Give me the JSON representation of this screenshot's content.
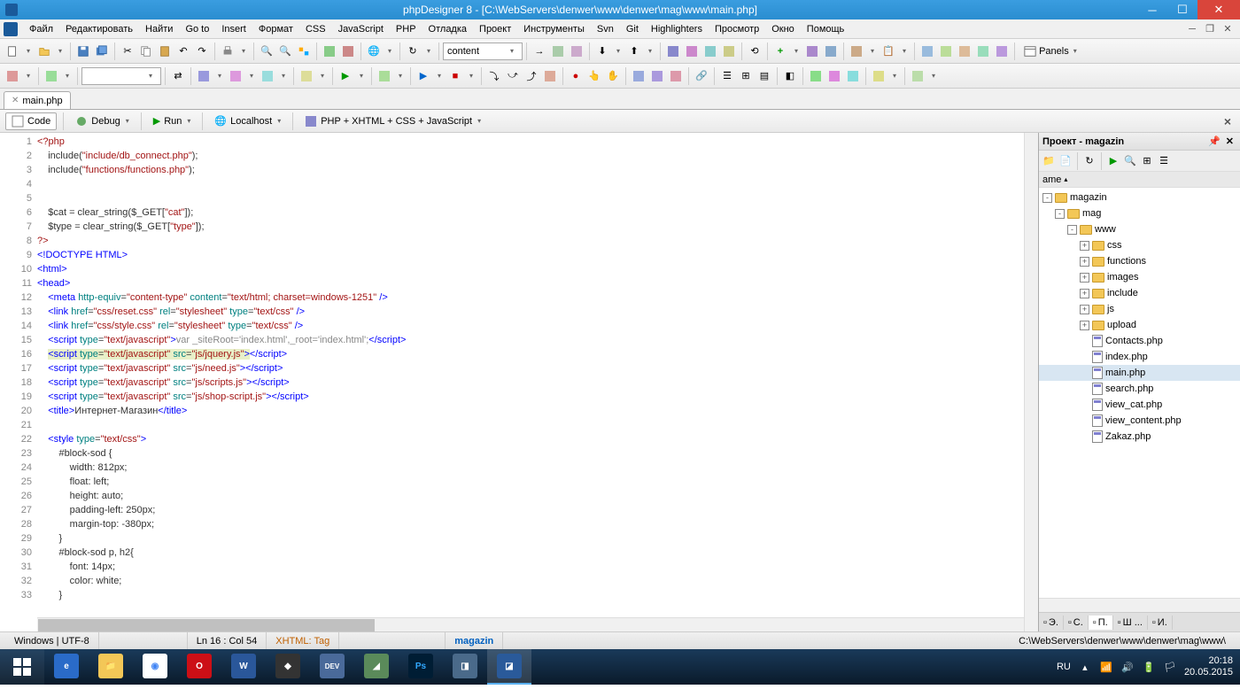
{
  "titlebar": {
    "text": "phpDesigner 8 - [C:\\WebServers\\denwer\\www\\denwer\\mag\\www\\main.php]"
  },
  "menu": [
    "Файл",
    "Редактировать",
    "Найти",
    "Go to",
    "Insert",
    "Формат",
    "CSS",
    "JavaScript",
    "PHP",
    "Отладка",
    "Проект",
    "Инструменты",
    "Svn",
    "Git",
    "Highlighters",
    "Просмотр",
    "Окно",
    "Помощь"
  ],
  "toolbar1": {
    "combo_content": "content",
    "panels_label": "Panels"
  },
  "tab": {
    "name": "main.php"
  },
  "subtoolbar": {
    "code": "Code",
    "debug": "Debug",
    "run": "Run",
    "localhost": "Localhost",
    "lang": "PHP + XHTML + CSS + JavaScript"
  },
  "code": {
    "lines": [
      {
        "n": 1,
        "html": "<span class='kw-red'>&lt;?php</span>"
      },
      {
        "n": 2,
        "html": "    include(<span class='kw-str'>\"include/db_connect.php\"</span>);"
      },
      {
        "n": 3,
        "html": "    include(<span class='kw-str'>\"functions/functions.php\"</span>);"
      },
      {
        "n": 4,
        "html": ""
      },
      {
        "n": 5,
        "html": ""
      },
      {
        "n": 6,
        "html": "    $cat = clear_string($_GET[<span class='kw-str'>\"cat\"</span>]);"
      },
      {
        "n": 7,
        "html": "    $type = clear_string($_GET[<span class='kw-str'>\"type\"</span>]);"
      },
      {
        "n": 8,
        "html": "<span class='kw-red'>?&gt;</span>"
      },
      {
        "n": 9,
        "html": "<span class='kw-blue'>&lt;!DOCTYPE HTML&gt;</span>"
      },
      {
        "n": 10,
        "html": "<span class='kw-blue'>&lt;html&gt;</span>"
      },
      {
        "n": 11,
        "html": "<span class='kw-blue'>&lt;head&gt;</span>"
      },
      {
        "n": 12,
        "html": "    <span class='kw-blue'>&lt;meta</span> <span class='kw-teal'>http-equiv</span>=<span class='kw-str'>\"content-type\"</span> <span class='kw-teal'>content</span>=<span class='kw-str'>\"text/html; charset=windows-1251\"</span> <span class='kw-blue'>/&gt;</span>"
      },
      {
        "n": 13,
        "html": "    <span class='kw-blue'>&lt;link</span> <span class='kw-teal'>href</span>=<span class='kw-str'>\"css/reset.css\"</span> <span class='kw-teal'>rel</span>=<span class='kw-str'>\"stylesheet\"</span> <span class='kw-teal'>type</span>=<span class='kw-str'>\"text/css\"</span> <span class='kw-blue'>/&gt;</span>"
      },
      {
        "n": 14,
        "html": "    <span class='kw-blue'>&lt;link</span> <span class='kw-teal'>href</span>=<span class='kw-str'>\"css/style.css\"</span> <span class='kw-teal'>rel</span>=<span class='kw-str'>\"stylesheet\"</span> <span class='kw-teal'>type</span>=<span class='kw-str'>\"text/css\"</span> <span class='kw-blue'>/&gt;</span>"
      },
      {
        "n": 15,
        "html": "    <span class='kw-blue'>&lt;script</span> <span class='kw-teal'>type</span>=<span class='kw-str'>\"text/javascript\"</span><span class='kw-blue'>&gt;</span><span class='kw-gray'>var _siteRoot='index.html',_root='index.html';</span><span class='kw-blue'>&lt;/script&gt;</span>"
      },
      {
        "n": 16,
        "html": "    <span style='background:#e8f0c8'><span class='kw-blue'>&lt;script</span> <span class='kw-teal'>type</span>=<span class='kw-str'>\"text/javascript\"</span> <span class='kw-teal'>src</span>=<span class='kw-str'>\"js/jquery.js\"</span><span class='kw-blue'>&gt;</span></span><span class='kw-blue'>&lt;/script&gt;</span>"
      },
      {
        "n": 17,
        "html": "    <span class='kw-blue'>&lt;script</span> <span class='kw-teal'>type</span>=<span class='kw-str'>\"text/javascript\"</span> <span class='kw-teal'>src</span>=<span class='kw-str'>\"js/need.js\"</span><span class='kw-blue'>&gt;&lt;/script&gt;</span>"
      },
      {
        "n": 18,
        "html": "    <span class='kw-blue'>&lt;script</span> <span class='kw-teal'>type</span>=<span class='kw-str'>\"text/javascript\"</span> <span class='kw-teal'>src</span>=<span class='kw-str'>\"js/scripts.js\"</span><span class='kw-blue'>&gt;&lt;/script&gt;</span>"
      },
      {
        "n": 19,
        "html": "    <span class='kw-blue'>&lt;script</span> <span class='kw-teal'>type</span>=<span class='kw-str'>\"text/javascript\"</span> <span class='kw-teal'>src</span>=<span class='kw-str'>\"js/shop-script.js\"</span><span class='kw-blue'>&gt;&lt;/script&gt;</span>"
      },
      {
        "n": 20,
        "html": "    <span class='kw-blue'>&lt;title&gt;</span>Интернет-Магазин<span class='kw-blue'>&lt;/title&gt;</span>"
      },
      {
        "n": 21,
        "html": ""
      },
      {
        "n": 22,
        "html": "    <span class='kw-blue'>&lt;style</span> <span class='kw-teal'>type</span>=<span class='kw-str'>\"text/css\"</span><span class='kw-blue'>&gt;</span>"
      },
      {
        "n": 23,
        "html": "        #block-sod {"
      },
      {
        "n": 24,
        "html": "            width: 812px;"
      },
      {
        "n": 25,
        "html": "            float: left;"
      },
      {
        "n": 26,
        "html": "            height: auto;"
      },
      {
        "n": 27,
        "html": "            padding-left: 250px;"
      },
      {
        "n": 28,
        "html": "            margin-top: -380px;"
      },
      {
        "n": 29,
        "html": "        }"
      },
      {
        "n": 30,
        "html": "        #block-sod p, h2{"
      },
      {
        "n": 31,
        "html": "            font: 14px;"
      },
      {
        "n": 32,
        "html": "            color: white;"
      },
      {
        "n": 33,
        "html": "        }"
      }
    ]
  },
  "project": {
    "title": "Проект - magazin",
    "header2": "ame",
    "tree": [
      {
        "ind": 0,
        "exp": "-",
        "type": "folder",
        "label": "magazin"
      },
      {
        "ind": 1,
        "exp": "-",
        "type": "folder",
        "label": "mag"
      },
      {
        "ind": 2,
        "exp": "-",
        "type": "folder",
        "label": "www"
      },
      {
        "ind": 3,
        "exp": "+",
        "type": "folder",
        "label": "css"
      },
      {
        "ind": 3,
        "exp": "+",
        "type": "folder",
        "label": "functions"
      },
      {
        "ind": 3,
        "exp": "+",
        "type": "folder",
        "label": "images"
      },
      {
        "ind": 3,
        "exp": "+",
        "type": "folder",
        "label": "include"
      },
      {
        "ind": 3,
        "exp": "+",
        "type": "folder",
        "label": "js"
      },
      {
        "ind": 3,
        "exp": "+",
        "type": "folder",
        "label": "upload"
      },
      {
        "ind": 3,
        "exp": " ",
        "type": "file",
        "label": "Contacts.php"
      },
      {
        "ind": 3,
        "exp": " ",
        "type": "file",
        "label": "index.php"
      },
      {
        "ind": 3,
        "exp": " ",
        "type": "file",
        "label": "main.php",
        "selected": true
      },
      {
        "ind": 3,
        "exp": " ",
        "type": "file",
        "label": "search.php"
      },
      {
        "ind": 3,
        "exp": " ",
        "type": "file",
        "label": "view_cat.php"
      },
      {
        "ind": 3,
        "exp": " ",
        "type": "file",
        "label": "view_content.php"
      },
      {
        "ind": 3,
        "exp": " ",
        "type": "file",
        "label": "Zakaz.php"
      }
    ],
    "tabs": [
      "Э.",
      "С.",
      "П.",
      "Ш ...",
      "И."
    ]
  },
  "status": {
    "encoding": "Windows | UTF-8",
    "cursor": "Ln   16 : Col  54",
    "context": "XHTML: Tag",
    "project": "magazin",
    "path": "C:\\WebServers\\denwer\\www\\denwer\\mag\\www\\"
  },
  "taskbar": {
    "lang": "RU",
    "time": "20:18",
    "date": "20.05.2015"
  }
}
